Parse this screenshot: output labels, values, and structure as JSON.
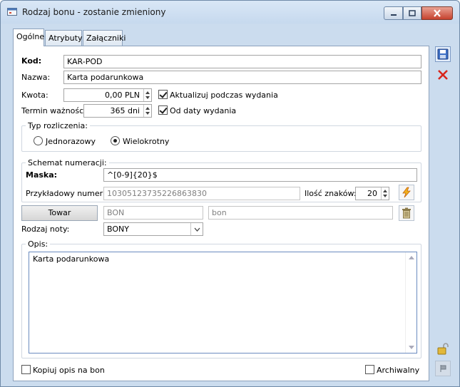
{
  "window": {
    "title": "Rodzaj bonu - zostanie zmieniony",
    "minimize_icon": "minimize-icon",
    "maximize_icon": "maximize-icon",
    "close_icon": "close-icon"
  },
  "tabs": [
    {
      "label": "Ogólne",
      "active": true
    },
    {
      "label": "Atrybuty",
      "active": false
    },
    {
      "label": "Załączniki",
      "active": false
    }
  ],
  "form": {
    "kod_label": "Kod:",
    "kod_value": "KAR-POD",
    "nazwa_label": "Nazwa:",
    "nazwa_value": "Karta podarunkowa",
    "kwota_label": "Kwota:",
    "kwota_value": "0,00 PLN",
    "aktualizuj_label": "Aktualizuj podczas wydania",
    "aktualizuj_checked": true,
    "termin_label": "Termin ważności:",
    "termin_value": "365 dni",
    "od_daty_label": "Od daty wydania",
    "od_daty_checked": true
  },
  "typ_rozliczenia": {
    "title": "Typ rozliczenia:",
    "options": [
      {
        "label": "Jednorazowy",
        "selected": false
      },
      {
        "label": "Wielokrotny",
        "selected": true
      }
    ]
  },
  "schemat": {
    "title": "Schemat numeracji:",
    "maska_label": "Maska:",
    "maska_value": "^[0-9]{20}$",
    "przykladowy_label": "Przykładowy numer:",
    "przykladowy_value": "10305123735226863830",
    "ilosc_label": "Ilość znaków:",
    "ilosc_value": "20",
    "generate_icon": "lightning-icon"
  },
  "towar": {
    "button_label": "Towar",
    "code": "BON",
    "name": "bon",
    "delete_icon": "trash-icon"
  },
  "rodzaj_noty": {
    "label": "Rodzaj noty:",
    "value": "BONY"
  },
  "opis": {
    "title": "Opis:",
    "text": "Karta podarunkowa"
  },
  "footer": {
    "kopiuj_label": "Kopiuj opis na bon",
    "kopiuj_checked": false,
    "archiwalny_label": "Archiwalny",
    "archiwalny_checked": false
  },
  "side_toolbar": {
    "save_icon": "save-icon",
    "cancel_icon": "cancel-icon",
    "lock_icon": "lock-icon",
    "pin_icon": "pin-icon"
  }
}
